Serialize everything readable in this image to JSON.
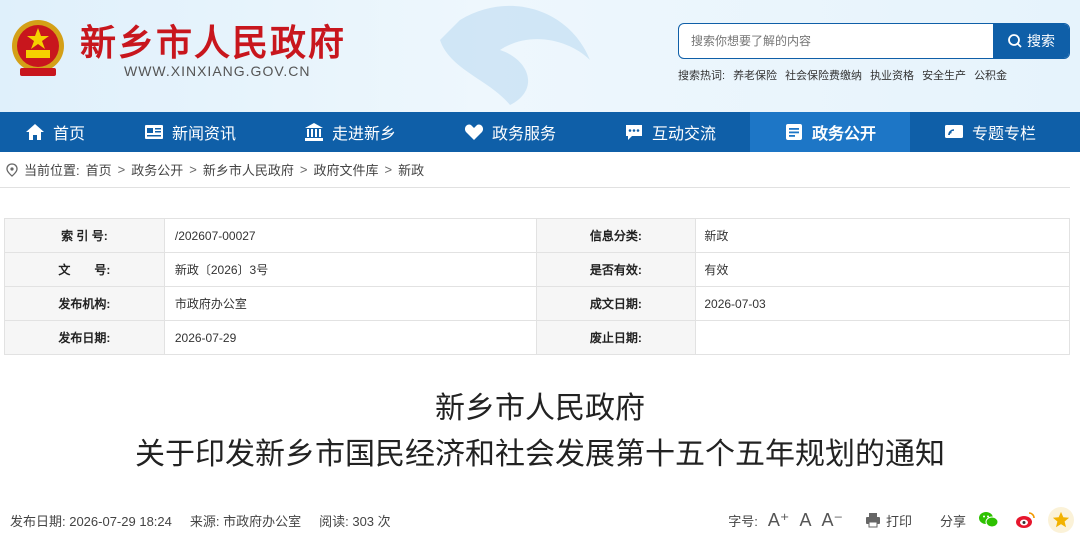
{
  "header": {
    "site_title": "新乡市人民政府",
    "site_url": "WWW.XINXIANG.GOV.CN",
    "search_placeholder": "搜索你想要了解的内容",
    "search_button": "搜索",
    "hot_label": "搜索热词:",
    "hot_words": [
      "养老保险",
      "社会保险费缴纳",
      "执业资格",
      "安全生产",
      "公积金"
    ]
  },
  "nav": {
    "items": [
      {
        "label": "首页",
        "icon": "home-icon"
      },
      {
        "label": "新闻资讯",
        "icon": "news-icon"
      },
      {
        "label": "走进新乡",
        "icon": "building-icon"
      },
      {
        "label": "政务服务",
        "icon": "heart-icon"
      },
      {
        "label": "互动交流",
        "icon": "chat-icon"
      },
      {
        "label": "政务公开",
        "icon": "document-icon",
        "active": true
      },
      {
        "label": "专题专栏",
        "icon": "topic-icon"
      }
    ]
  },
  "breadcrumb": {
    "prefix": "当前位置:",
    "items": [
      "首页",
      "政务公开",
      "新乡市人民政府",
      "政府文件库",
      "新政"
    ],
    "sep": ">"
  },
  "info": {
    "rows": [
      {
        "l1": "索 引 号:",
        "v1": "/202607-00027",
        "l2": "信息分类:",
        "v2": "新政"
      },
      {
        "l1": "文　　号:",
        "v1": "新政〔2026〕3号",
        "l2": "是否有效:",
        "v2": "有效"
      },
      {
        "l1": "发布机构:",
        "v1": "市政府办公室",
        "l2": "成文日期:",
        "v2": "2026-07-03"
      },
      {
        "l1": "发布日期:",
        "v1": "2026-07-29",
        "l2": "废止日期:",
        "v2": ""
      }
    ]
  },
  "doc": {
    "title_line1": "新乡市人民政府",
    "title_line2": "关于印发新乡市国民经济和社会发展第十五个五年规划的通知"
  },
  "meta": {
    "publish": "发布日期: 2026-07-29 18:24",
    "source": "来源: 市政府办公室",
    "views": "阅读: 303 次",
    "font_label": "字号:",
    "font_large": "A⁺",
    "font_mid": "A",
    "font_small": "A⁻",
    "print": "打印",
    "share": "分享"
  },
  "colors": {
    "nav_blue": "#0f5fa8",
    "nav_active": "#1d76c6",
    "title_red": "#c8161d"
  }
}
